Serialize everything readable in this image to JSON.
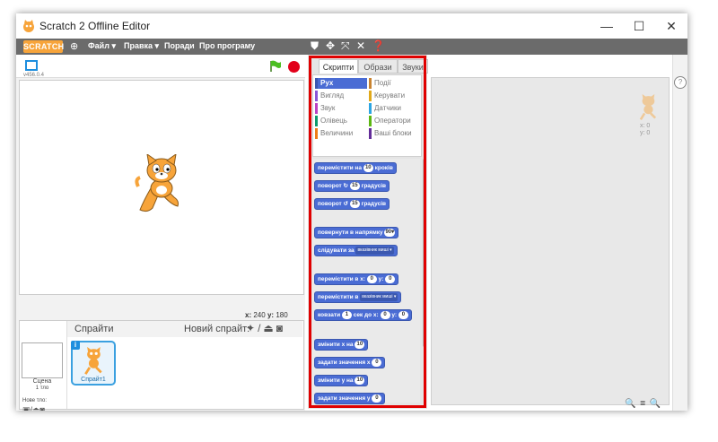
{
  "window": {
    "title": "Scratch 2 Offline Editor",
    "minimize": "—",
    "maximize": "☐",
    "close": "✕"
  },
  "menubar": {
    "logo": "SCRATCH",
    "items": [
      "Файл ▾",
      "Правка ▾",
      "Поради",
      "Про програму"
    ]
  },
  "stage": {
    "version": "v456.0.4",
    "coords": {
      "x_label": "x:",
      "x": "240",
      "y_label": "y:",
      "y": "180"
    }
  },
  "sprites": {
    "title": "Спрайти",
    "new_sprite": "Новий спрайт:",
    "scene_label": "Сцена",
    "scene_sub": "1 тло",
    "new_backdrop": "Нове тло:",
    "sprite_name": "Спрайт1"
  },
  "palette": {
    "tabs": [
      "Скрипти",
      "Образи",
      "Звуки"
    ],
    "categories": [
      {
        "label": "Рух",
        "color": "#4a6cd4",
        "active": true
      },
      {
        "label": "Події",
        "color": "#c88330"
      },
      {
        "label": "Вигляд",
        "color": "#8a55d7"
      },
      {
        "label": "Керувати",
        "color": "#e1a91a"
      },
      {
        "label": "Звук",
        "color": "#bb42c3"
      },
      {
        "label": "Датчики",
        "color": "#2ca5e2"
      },
      {
        "label": "Олівець",
        "color": "#0e9a6c"
      },
      {
        "label": "Оператори",
        "color": "#5cb712"
      },
      {
        "label": "Величини",
        "color": "#ee7d16"
      },
      {
        "label": "Ваші блоки",
        "color": "#632d99"
      }
    ],
    "blocks": {
      "b1": {
        "pre": "перемістити на",
        "a1": "10",
        "post": "кроків"
      },
      "b2": {
        "pre": "поворот ↻",
        "a1": "15",
        "post": "градусів"
      },
      "b3": {
        "pre": "поворот ↺",
        "a1": "15",
        "post": "градусів"
      },
      "b4": {
        "pre": "повернути в напрямку",
        "a1": "90▾"
      },
      "b5": {
        "pre": "слідувати за",
        "d1": "вказівник миші ▾"
      },
      "b6": {
        "pre": "перемістити в x:",
        "a1": "0",
        "mid": "y:",
        "a2": "0"
      },
      "b7": {
        "pre": "перемістити в",
        "d1": "вказівник миші ▾"
      },
      "b8": {
        "pre": "ковзати",
        "a1": "1",
        "mid": "сек до x:",
        "a2": "0",
        "mid2": "y:",
        "a3": "0"
      },
      "b9": {
        "pre": "змінити х на",
        "a1": "10"
      },
      "b10": {
        "pre": "задати значення х",
        "a1": "0"
      },
      "b11": {
        "pre": "змінити у на",
        "a1": "10"
      },
      "b12": {
        "pre": "задати значення у",
        "a1": "0"
      }
    }
  },
  "script_area": {
    "x_label": "x: 0",
    "y_label": "y: 0",
    "zoom": "🔍 = 🔍"
  },
  "colors": {
    "motion": "#4a6cd4",
    "menubar": "#6b6b6b",
    "highlight_frame": "#e00000"
  }
}
